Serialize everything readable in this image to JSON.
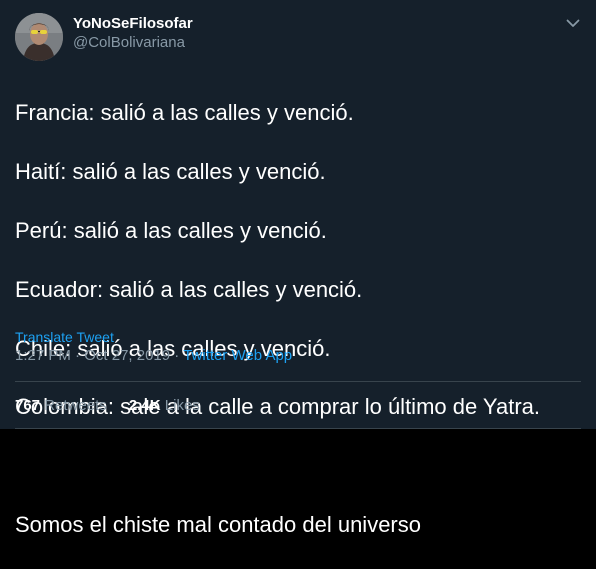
{
  "author": {
    "display_name": "YoNoSeFilosofar",
    "handle": "@ColBolivariana"
  },
  "tweet": {
    "lines": [
      "Francia: salió a las calles y venció.",
      "Haití: salió a las calles y venció.",
      "Perú: salió a las calles y venció.",
      "Ecuador: salió a las calles y venció.",
      "Chile: salió a las calles y venció.",
      "Colombia: sale a la calle a comprar lo último de Yatra.",
      "",
      "Somos el chiste mal contado del universo"
    ]
  },
  "translate_label": "Translate Tweet",
  "meta": {
    "time": "1:27 PM",
    "separator": "·",
    "date": "Oct 27, 2019",
    "source": "Twitter Web App"
  },
  "stats": {
    "retweets_count": "767",
    "retweets_label": "Retweets",
    "likes_count": "2.4K",
    "likes_label": "Likes"
  },
  "colors": {
    "background": "#15202b",
    "text": "#ffffff",
    "muted": "#8899a6",
    "link": "#1da1f2",
    "divider": "#38444d"
  },
  "icons": {
    "menu": "chevron-down-icon"
  }
}
